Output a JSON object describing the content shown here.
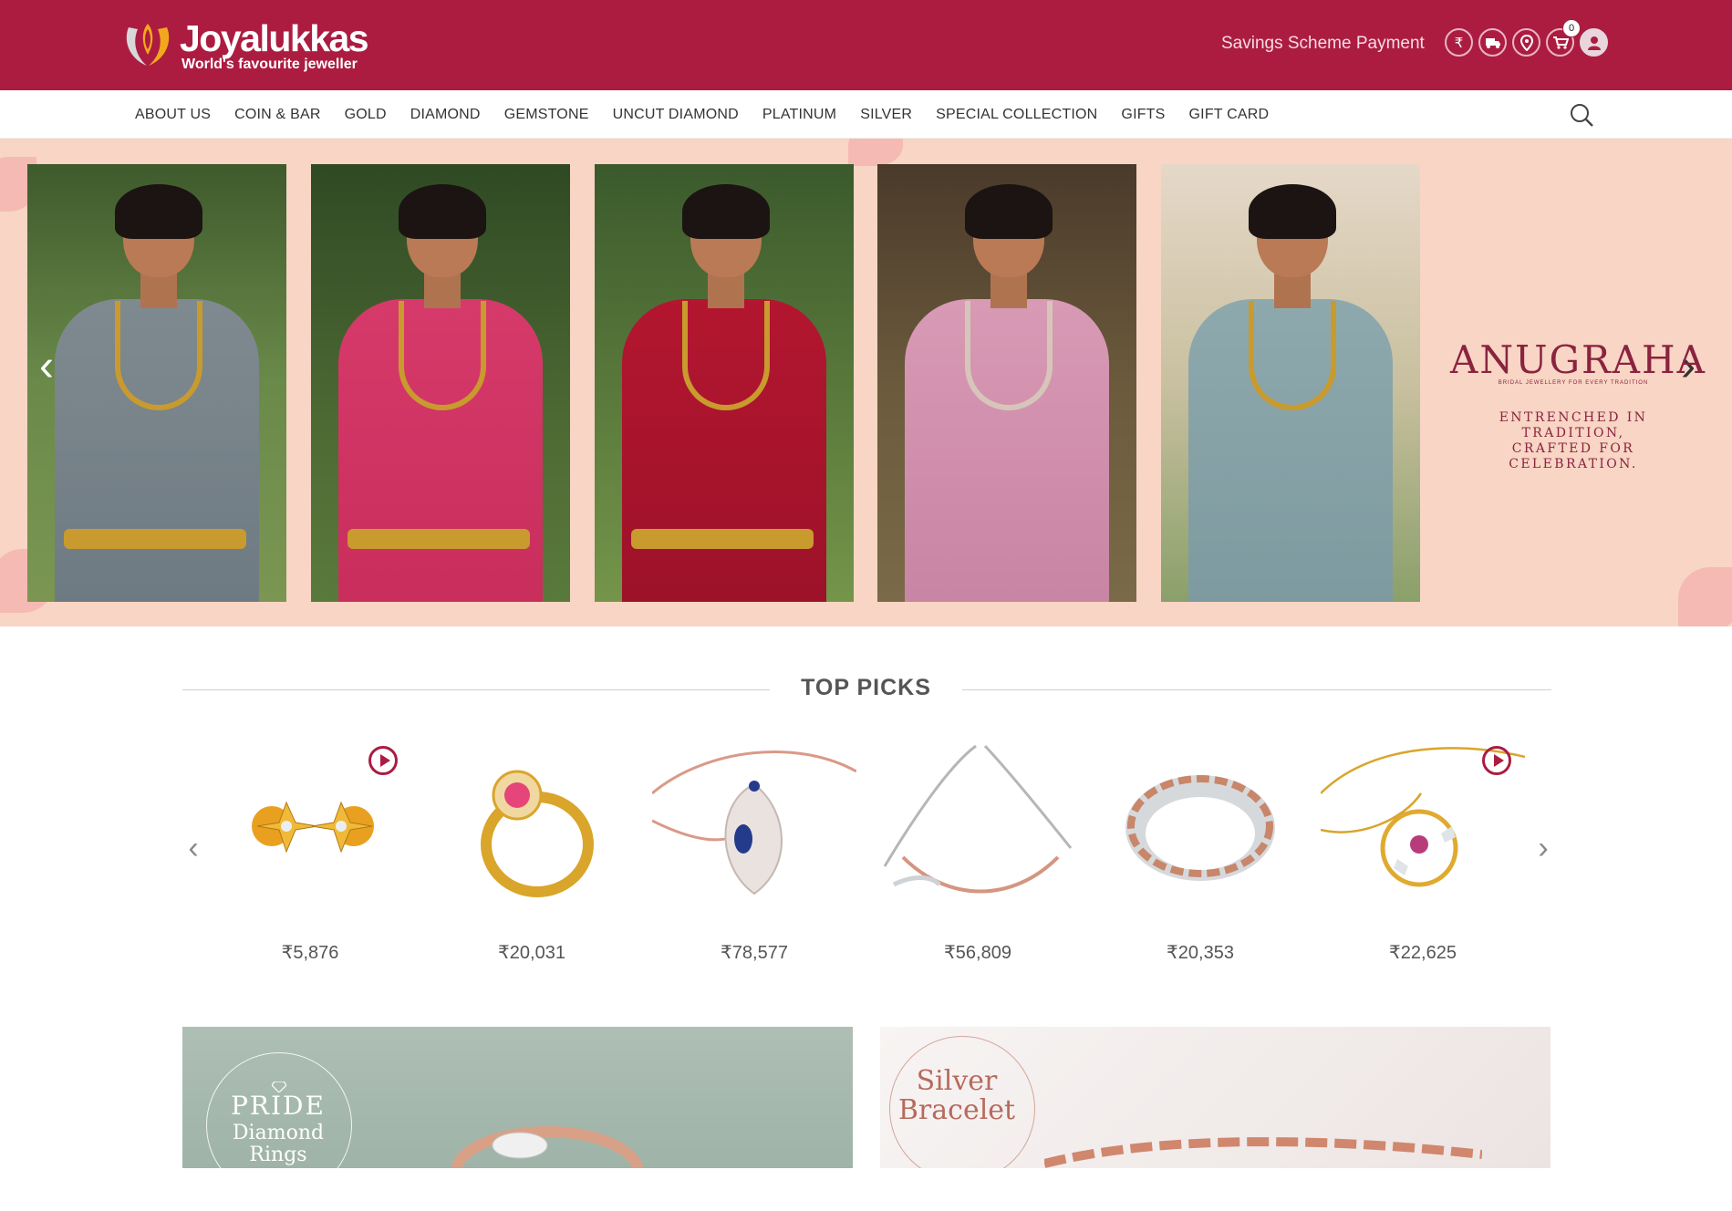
{
  "header": {
    "brand_name": "Joyalukkas",
    "tagline": "World's favourite jeweller",
    "savings_link": "Savings Scheme Payment",
    "icons": [
      "rupee-icon",
      "truck-icon",
      "location-pin-icon",
      "cart-icon",
      "user-icon"
    ],
    "rupee_glyph": "₹",
    "cart_count": "0",
    "brand_color": "#ac1c41"
  },
  "nav": {
    "items": [
      "ABOUT US",
      "COIN & BAR",
      "GOLD",
      "DIAMOND",
      "GEMSTONE",
      "UNCUT DIAMOND",
      "PLATINUM",
      "SILVER",
      "SPECIAL COLLECTION",
      "GIFTS",
      "GIFT CARD"
    ]
  },
  "hero": {
    "collection_title": "ANUGRAHA",
    "collection_subtitle": "BRIDAL JEWELLERY FOR EVERY TRADITION",
    "tagline_line1": "ENTRENCHED IN TRADITION,",
    "tagline_line2": "CRAFTED FOR CELEBRATION.",
    "background_color": "#f8d5c4"
  },
  "top_picks": {
    "title": "TOP PICKS",
    "products": [
      {
        "name": "earrings",
        "price": "5,876",
        "has_video": true
      },
      {
        "name": "ring",
        "price": "20,031",
        "has_video": false
      },
      {
        "name": "pendant",
        "price": "78,577",
        "has_video": false
      },
      {
        "name": "necklace",
        "price": "56,809",
        "has_video": false
      },
      {
        "name": "band-ring",
        "price": "20,353",
        "has_video": false
      },
      {
        "name": "pendant-chain",
        "price": "22,625",
        "has_video": true
      }
    ],
    "currency_glyph": "₹"
  },
  "banners": {
    "left_line1": "PRIDE",
    "left_line2": "Diamond",
    "left_line3": "Rings",
    "right_line1": "Silver",
    "right_line2": "Bracelet"
  }
}
